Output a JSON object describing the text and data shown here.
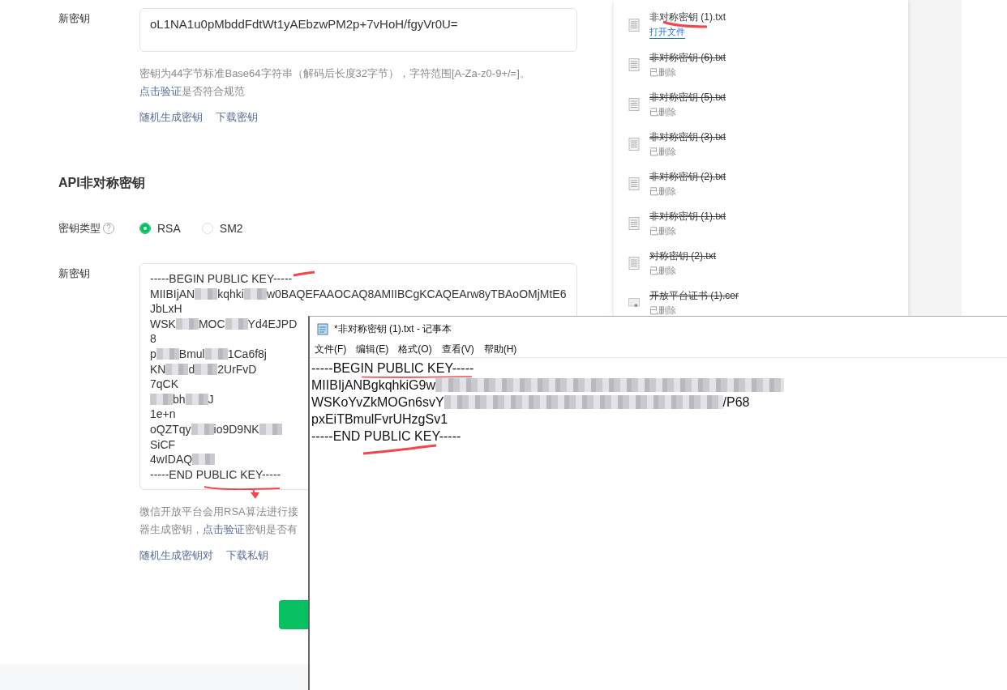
{
  "symmetric_key": {
    "label": "新密钥",
    "value": "oL1NA1u0pMbddFdtWt1yAEbzwPM2p+7vHoH/fgyVr0U=",
    "hint": "密钥为44字节标准Base64字符串（解码后长度32字节），字符范围[A-Za-z0-9+/=]。",
    "verify_link": "点击验证",
    "verify_rest": "是否符合规范",
    "actions": [
      "随机生成密钥",
      "下载密钥"
    ]
  },
  "asymmetric": {
    "title": "API非对称密钥",
    "type_label": "密钥类型",
    "help_icon": "?",
    "types": [
      {
        "label": "RSA",
        "selected": true
      },
      {
        "label": "SM2",
        "selected": false
      }
    ],
    "key_label": "新密钥",
    "key_lines": [
      [
        {
          "kind": "text",
          "text": "-----BEGIN PUBLIC KEY-----"
        }
      ],
      [
        {
          "kind": "text",
          "text": "MIIBIjAN"
        },
        {
          "kind": "blur"
        },
        {
          "kind": "text",
          "text": "kqhki"
        },
        {
          "kind": "blur"
        },
        {
          "kind": "text",
          "text": "w0BAQEFAAOCAQ8AMIIBCgKCAQEArw8yTBAoOMjMtE6"
        }
      ],
      [
        {
          "kind": "text",
          "text": "JbLxH"
        }
      ],
      [
        {
          "kind": "text",
          "text": "WSK"
        },
        {
          "kind": "blur"
        },
        {
          "kind": "text",
          "text": "MOC"
        },
        {
          "kind": "blur"
        },
        {
          "kind": "text",
          "text": "Yd4EJPD"
        }
      ],
      [
        {
          "kind": "text",
          "text": "8"
        }
      ],
      [
        {
          "kind": "text",
          "text": "p"
        },
        {
          "kind": "blur"
        },
        {
          "kind": "text",
          "text": "Bmul"
        },
        {
          "kind": "blur"
        },
        {
          "kind": "text",
          "text": "1Ca6f8j"
        }
      ],
      [
        {
          "kind": "text",
          "text": "KN"
        },
        {
          "kind": "blur"
        },
        {
          "kind": "text",
          "text": "d"
        },
        {
          "kind": "blur"
        },
        {
          "kind": "text",
          "text": "2UrFvD"
        }
      ],
      [
        {
          "kind": "text",
          "text": "7qCK"
        }
      ],
      [
        {
          "kind": "blur"
        },
        {
          "kind": "text",
          "text": "bh"
        },
        {
          "kind": "blur"
        },
        {
          "kind": "text",
          "text": "J"
        }
      ],
      [
        {
          "kind": "text",
          "text": "1e+n"
        }
      ],
      [
        {
          "kind": "text",
          "text": "oQZTqy"
        },
        {
          "kind": "blur"
        },
        {
          "kind": "text",
          "text": "io9D9NK"
        },
        {
          "kind": "blur"
        }
      ],
      [
        {
          "kind": "text",
          "text": "SiCF"
        }
      ],
      [
        {
          "kind": "text",
          "text": "4wIDAQ"
        },
        {
          "kind": "blur"
        }
      ],
      [
        {
          "kind": "text",
          "text": "-----END PUBLIC KEY-----"
        }
      ]
    ],
    "hint_line1": "微信开放平台会用RSA算法进行接",
    "hint_line2_start": "器生成密钥，",
    "verify_link": "点击验证",
    "hint_line2_end": "密钥是否有",
    "actions": [
      "随机生成密钥对",
      "下载私钥"
    ]
  },
  "downloads": [
    {
      "name": "非对称密钥 (1).txt",
      "status": "打开文件",
      "deleted": false,
      "kind": "text"
    },
    {
      "name": "非对称密钥 (6).txt",
      "status": "已删除",
      "deleted": true,
      "kind": "text"
    },
    {
      "name": "非对称密钥 (5).txt",
      "status": "已删除",
      "deleted": true,
      "kind": "text"
    },
    {
      "name": "非对称密钥 (3).txt",
      "status": "已删除",
      "deleted": true,
      "kind": "text"
    },
    {
      "name": "非对称密钥 (2).txt",
      "status": "已删除",
      "deleted": true,
      "kind": "text"
    },
    {
      "name": "非对称密钥 (1).txt",
      "status": "已删除",
      "deleted": true,
      "kind": "text"
    },
    {
      "name": "对称密钥 (2).txt",
      "status": "已删除",
      "deleted": true,
      "kind": "text"
    },
    {
      "name": "开放平台证书 (1).cer",
      "status": "已删除",
      "deleted": true,
      "kind": "certificate"
    }
  ],
  "notepad": {
    "title": "*非对称密钥 (1).txt - 记事本",
    "menu": [
      "文件(F)",
      "编辑(E)",
      "格式(O)",
      "查看(V)",
      "帮助(H)"
    ],
    "lines": [
      [
        {
          "kind": "text",
          "text": "-----BEGIN PUBLIC KEY-----"
        }
      ],
      [
        {
          "kind": "text",
          "text": "MIIBIjANBgkqhkiG9w"
        },
        {
          "kind": "blur"
        }
      ],
      [
        {
          "kind": "text",
          "text": "WSKoYvZkMOGn6svY"
        },
        {
          "kind": "blur"
        },
        {
          "kind": "text",
          "text": "/P68"
        }
      ],
      [
        {
          "kind": "text",
          "text": "pxEiTBmulFvrUHzgSv1"
        }
      ],
      [
        {
          "kind": "text",
          "text": "-----END PUBLIC KEY-----"
        }
      ]
    ]
  }
}
